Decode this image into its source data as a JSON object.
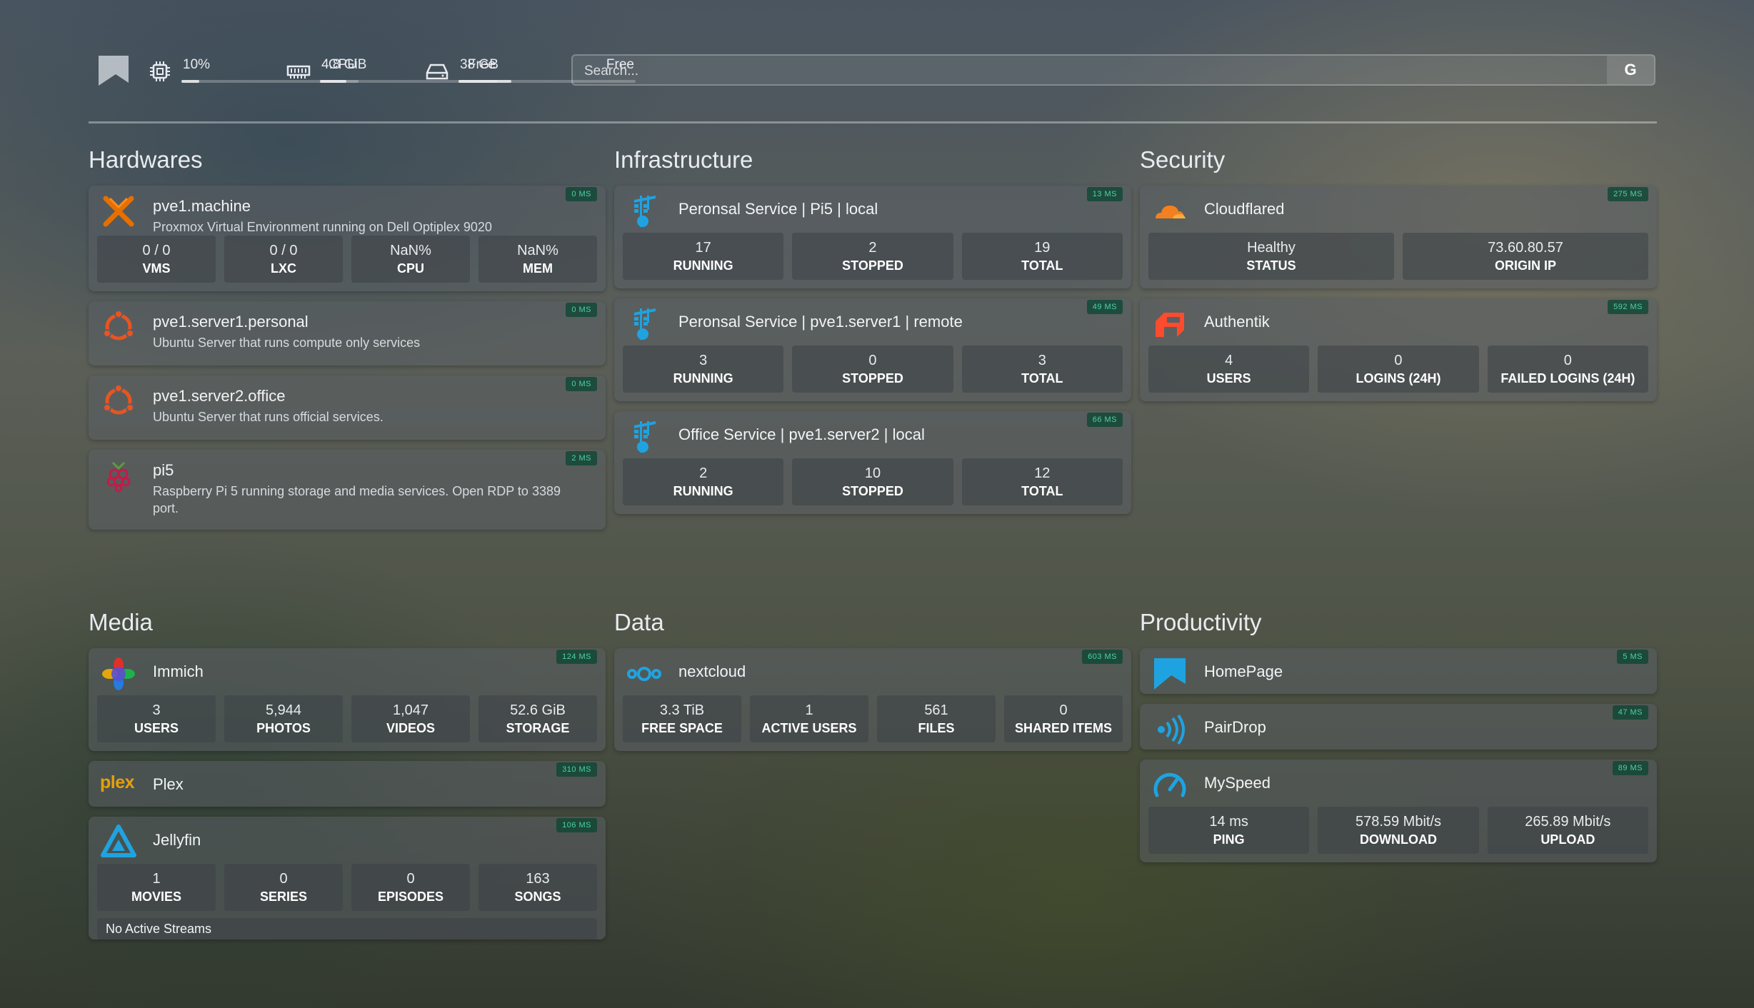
{
  "header": {
    "cpu": {
      "value": "10%",
      "label": "CPU",
      "level": 0.1
    },
    "memory": {
      "value": "4.8 GiB",
      "label": "Free",
      "level": 0.15
    },
    "disk": {
      "value": "38 GB",
      "label": "Free",
      "level": 0.3
    },
    "search": {
      "placeholder": "Search...",
      "provider": "G"
    }
  },
  "groups": {
    "hardwares": {
      "title": "Hardwares",
      "services": [
        {
          "name": "pve1.machine",
          "desc": "Proxmox Virtual Environment running on Dell Optiplex 9020",
          "ping": "0 MS",
          "stats": [
            {
              "v": "0 / 0",
              "l": "VMS"
            },
            {
              "v": "0 / 0",
              "l": "LXC"
            },
            {
              "v": "NaN%",
              "l": "CPU"
            },
            {
              "v": "NaN%",
              "l": "MEM"
            }
          ]
        },
        {
          "name": "pve1.server1.personal",
          "desc": "Ubuntu Server that runs compute only services",
          "ping": "0 MS"
        },
        {
          "name": "pve1.server2.office",
          "desc": "Ubuntu Server that runs official services.",
          "ping": "0 MS"
        },
        {
          "name": "pi5",
          "desc": "Raspberry Pi 5 running storage and media services. Open RDP to 3389 port.",
          "ping": "2 MS"
        }
      ]
    },
    "infrastructure": {
      "title": "Infrastructure",
      "services": [
        {
          "name": "Peronsal Service | Pi5 | local",
          "ping": "13 MS",
          "stats": [
            {
              "v": "17",
              "l": "RUNNING"
            },
            {
              "v": "2",
              "l": "STOPPED"
            },
            {
              "v": "19",
              "l": "TOTAL"
            }
          ]
        },
        {
          "name": "Peronsal Service | pve1.server1 | remote",
          "ping": "49 MS",
          "stats": [
            {
              "v": "3",
              "l": "RUNNING"
            },
            {
              "v": "0",
              "l": "STOPPED"
            },
            {
              "v": "3",
              "l": "TOTAL"
            }
          ]
        },
        {
          "name": "Office Service | pve1.server2 | local",
          "ping": "66 MS",
          "stats": [
            {
              "v": "2",
              "l": "RUNNING"
            },
            {
              "v": "10",
              "l": "STOPPED"
            },
            {
              "v": "12",
              "l": "TOTAL"
            }
          ]
        }
      ]
    },
    "security": {
      "title": "Security",
      "services": [
        {
          "name": "Cloudflared",
          "ping": "275 MS",
          "stats": [
            {
              "v": "Healthy",
              "l": "STATUS"
            },
            {
              "v": "73.60.80.57",
              "l": "ORIGIN IP"
            }
          ]
        },
        {
          "name": "Authentik",
          "ping": "592 MS",
          "stats": [
            {
              "v": "4",
              "l": "USERS"
            },
            {
              "v": "0",
              "l": "LOGINS (24H)"
            },
            {
              "v": "0",
              "l": "FAILED LOGINS (24H)"
            }
          ]
        }
      ]
    },
    "media": {
      "title": "Media",
      "services": [
        {
          "name": "Immich",
          "ping": "124 MS",
          "stats": [
            {
              "v": "3",
              "l": "USERS"
            },
            {
              "v": "5,944",
              "l": "PHOTOS"
            },
            {
              "v": "1,047",
              "l": "VIDEOS"
            },
            {
              "v": "52.6 GiB",
              "l": "STORAGE"
            }
          ]
        },
        {
          "name": "Plex",
          "ping": "310 MS",
          "logo_text": "plex"
        },
        {
          "name": "Jellyfin",
          "ping": "106 MS",
          "stats": [
            {
              "v": "1",
              "l": "MOVIES"
            },
            {
              "v": "0",
              "l": "SERIES"
            },
            {
              "v": "0",
              "l": "EPISODES"
            },
            {
              "v": "163",
              "l": "SONGS"
            }
          ],
          "note": "No Active Streams"
        }
      ]
    },
    "data": {
      "title": "Data",
      "services": [
        {
          "name": "nextcloud",
          "ping": "603 MS",
          "stats": [
            {
              "v": "3.3 TiB",
              "l": "FREE SPACE"
            },
            {
              "v": "1",
              "l": "ACTIVE USERS"
            },
            {
              "v": "561",
              "l": "FILES"
            },
            {
              "v": "0",
              "l": "SHARED ITEMS"
            }
          ]
        }
      ]
    },
    "productivity": {
      "title": "Productivity",
      "services": [
        {
          "name": "HomePage",
          "ping": "5 MS"
        },
        {
          "name": "PairDrop",
          "ping": "47 MS"
        },
        {
          "name": "MySpeed",
          "ping": "89 MS",
          "stats": [
            {
              "v": "14 ms",
              "l": "PING"
            },
            {
              "v": "578.59 Mbit/s",
              "l": "DOWNLOAD"
            },
            {
              "v": "265.89 Mbit/s",
              "l": "UPLOAD"
            }
          ]
        }
      ]
    }
  },
  "icons": {
    "proxmox": "proxmox-icon",
    "ubuntu": "ubuntu-icon",
    "raspberry": "raspberry-pi-icon",
    "portainer": "portainer-icon",
    "cloudflare": "cloudflare-icon",
    "authentik": "authentik-icon",
    "immich": "immich-icon",
    "plex": "plex-logo",
    "jellyfin": "jellyfin-icon",
    "nextcloud": "nextcloud-icon",
    "homepage": "homepage-icon",
    "pairdrop": "pairdrop-icon",
    "myspeed": "speedometer-icon"
  },
  "colors": {
    "ping_text": "#4fd1a5",
    "accent_blue": "#1fa3e0",
    "proxmox_orange": "#e57000",
    "ubuntu_orange": "#e95420",
    "plex_yellow": "#e5a00d"
  }
}
